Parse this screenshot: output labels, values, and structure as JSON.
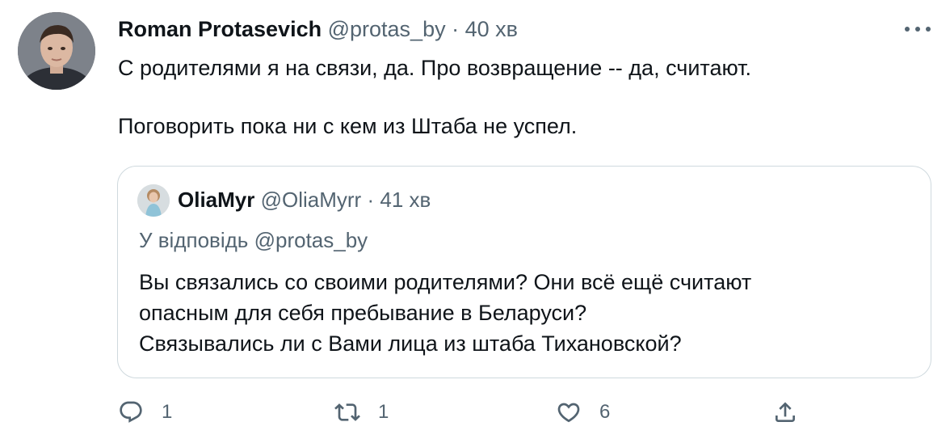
{
  "tweet": {
    "author_name": "Roman Protasevich",
    "handle": "@protas_by",
    "separator": "·",
    "time": "40 хв",
    "text": "С родителями я на связи, да. Про возвращение -- да, считают.\n\nПоговорить пока ни с кем из Штаба  не успел.",
    "more_icon": "more-horizontal-icon"
  },
  "quote": {
    "author_name": "OliaMyr",
    "handle": "@OliaMyrr",
    "separator": "·",
    "time": "41 хв",
    "reply_prefix": "У відповідь",
    "reply_mention": "@protas_by",
    "text": "Вы связались со своими родителями? Они всё ещё считают\nопасным для себя пребывание в Беларуси?\nСвязывались ли с Вами лица из штаба Тихановской?"
  },
  "actions": {
    "reply_count": "1",
    "retweet_count": "1",
    "like_count": "6"
  },
  "colors": {
    "text": "#0f1419",
    "secondary": "#536471",
    "border": "#cfd9de"
  }
}
